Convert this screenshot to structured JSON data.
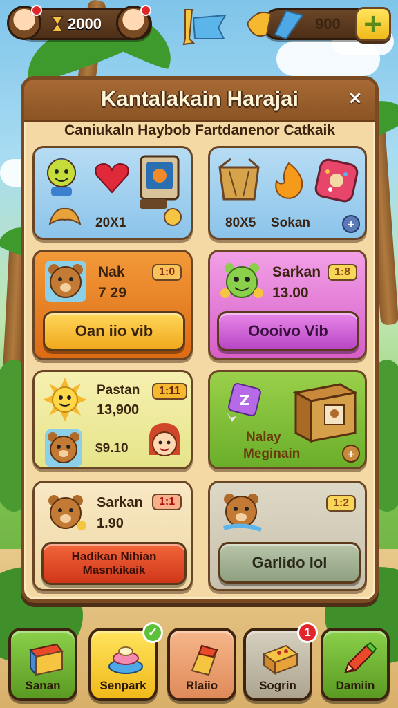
{
  "hud": {
    "left_currency_value": "2000",
    "right_currency_value": "900",
    "add_button_symbol": "+"
  },
  "panel": {
    "title": "Kantalakain Harajai",
    "subtitle": "Caniukaln Haybob Fartdanenor Catkaik",
    "close_symbol": "×"
  },
  "cards": {
    "c1": {
      "value_label": "20X1"
    },
    "c2": {
      "value_label": "80X5",
      "name_label": "Sokan"
    },
    "c3": {
      "name": "Nak",
      "badge": "1:0",
      "value": "7 29",
      "button": "Oan iio vib"
    },
    "c4": {
      "name": "Sarkan",
      "badge": "1:8",
      "value": "13.00",
      "button": "Oooivo Vib"
    },
    "c5": {
      "name": "Pastan",
      "badge": "1:11",
      "value": "13,900",
      "extra": "$9.10"
    },
    "c6": {
      "line1": "Nalay",
      "line2": "Meginain"
    },
    "c7": {
      "name": "Sarkan",
      "badge": "1:1",
      "value": "1.90",
      "button_line1": "Hadikan Nihian",
      "button_line2": "Masnkikaik"
    },
    "c8": {
      "badge": "1:2",
      "button": "Garlido lol"
    }
  },
  "nav": {
    "items": [
      {
        "label": "Sanan"
      },
      {
        "label": "Senpark"
      },
      {
        "label": "Rlaiio"
      },
      {
        "label": "Sogrin",
        "notification": "1"
      },
      {
        "label": "Damiin"
      }
    ]
  },
  "colors": {
    "panel_bg": "#f4d9a5",
    "panel_border": "#7a4a22",
    "orange_card": "#e8701c",
    "pink_card": "#e678d8",
    "green_card": "#7cbf3a",
    "notification_red": "#e0262b"
  },
  "icons": [
    "hourglass-icon",
    "avatar-icon",
    "ticket-icon",
    "gem-icon",
    "plus-icon",
    "close-icon",
    "heart-icon",
    "arcade-icon",
    "coin-icon",
    "crate-icon",
    "bear-icon",
    "sun-icon",
    "pencil-icon"
  ]
}
